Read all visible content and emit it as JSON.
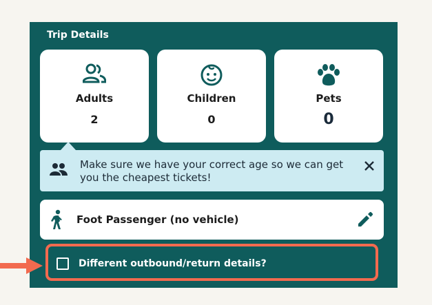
{
  "trip": {
    "title": "Trip Details",
    "cards": [
      {
        "label": "Adults",
        "count": "2",
        "icon": "adults-icon"
      },
      {
        "label": "Children",
        "count": "0",
        "icon": "child-face-icon"
      },
      {
        "label": "Pets",
        "count": "0",
        "icon": "paw-icon"
      }
    ]
  },
  "notice": {
    "message": "Make sure we have your correct age so we can get you the cheapest tickets!",
    "icon": "people-icon",
    "close_icon": "close-icon"
  },
  "passenger": {
    "label": "Foot Passenger (no vehicle)",
    "icon": "walking-person-icon",
    "edit_icon": "pencil-icon"
  },
  "different_details": {
    "label": "Different outbound/return details?",
    "checked": false
  },
  "colors": {
    "panel": "#0f5c5c",
    "notice_bg": "#cdebf2",
    "highlight": "#f26a4f",
    "page_bg": "#f7f5f0"
  }
}
